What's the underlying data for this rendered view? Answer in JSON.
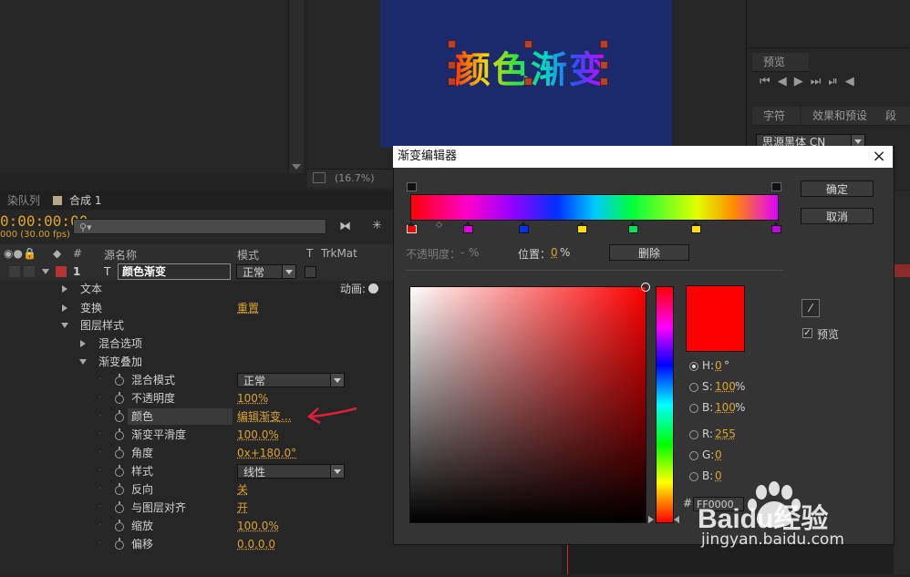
{
  "composition": {
    "title_text": "颜色渐变",
    "zoom_label": "(16.7%)"
  },
  "right_panels": {
    "preview_tab": "预览",
    "char_tab": "字符",
    "effects_tab": "效果和预设",
    "para_tab": "段",
    "font_name": "思源黑体 CN"
  },
  "timeline": {
    "tab_queue": "染队列",
    "tab_comp": "合成 1",
    "timecode": "0:00:00:00",
    "fps": "000 (30.00 fps)",
    "search_placeholder": "",
    "headers": {
      "hash": "#",
      "source": "源名称",
      "mode": "模式",
      "t": "T",
      "trkmat": "TrkMat"
    },
    "layer": {
      "index": "1",
      "name": "颜色渐变",
      "mode": "正常"
    },
    "animate_label": "动画:",
    "rows": {
      "text": "文本",
      "transform": "变换",
      "transform_reset": "重置",
      "layer_styles": "图层样式",
      "blending": "混合选项",
      "gradient_overlay": "渐变叠加"
    },
    "props": [
      {
        "name": "混合模式",
        "value": "正常",
        "type": "dropdown"
      },
      {
        "name": "不透明度",
        "value": "100%",
        "type": "value"
      },
      {
        "name": "颜色",
        "value": "编辑渐变...",
        "type": "value"
      },
      {
        "name": "渐变平滑度",
        "value": "100.0%",
        "type": "value"
      },
      {
        "name": "角度",
        "value": "0x+180.0°",
        "type": "value"
      },
      {
        "name": "样式",
        "value": "线性",
        "type": "dropdown"
      },
      {
        "name": "反向",
        "value": "关",
        "type": "value"
      },
      {
        "name": "与图层对齐",
        "value": "开",
        "type": "value"
      },
      {
        "name": "缩放",
        "value": "100.0%",
        "type": "value"
      },
      {
        "name": "偏移",
        "value": "0.0,0.0",
        "type": "value"
      }
    ]
  },
  "dialog": {
    "title": "渐变编辑器",
    "ok": "确定",
    "cancel": "取消",
    "opacity_label": "不透明度：",
    "opacity_value": "-",
    "opacity_unit": "%",
    "position_label": "位置：",
    "position_value": "0",
    "position_unit": "%",
    "delete": "删除",
    "preview_label": "预览",
    "preview_checked": true,
    "color": "#ff0000",
    "h_label": "H:",
    "h_value": "0",
    "h_unit": "°",
    "s_label": "S:",
    "s_value": "100",
    "s_unit": "%",
    "b_label": "B:",
    "b_value": "100",
    "b_unit": "%",
    "r_label": "R:",
    "r_value": "255",
    "g_label": "G:",
    "g_value": "0",
    "bb_label": "B:",
    "bb_value": "0",
    "hex_label": "#",
    "hex_value": "FF0000",
    "stops": [
      "#ff0000",
      "#e000e0",
      "#0030ff",
      "#ffe000",
      "#00e060",
      "#ffe000",
      "#c000e0"
    ]
  },
  "watermark": {
    "brand": "Baidu经验",
    "url": "jingyan.baidu.com"
  }
}
